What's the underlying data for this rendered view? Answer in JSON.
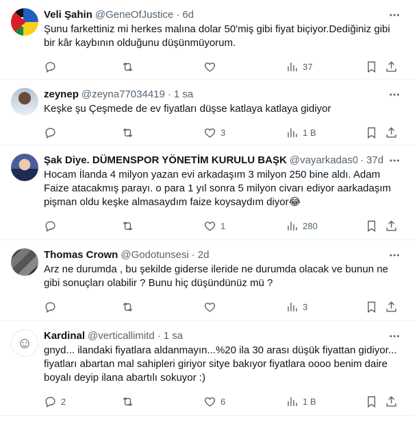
{
  "tweets": [
    {
      "name": "Veli Şahin",
      "handle": "@GeneOfJustice",
      "time": "6d",
      "text": "Şunu farkettiniz mi herkes malına dolar 50'miş gibi fiyat biçiyor.Dediğiniz gibi bir kâr kaybının olduğunu düşünmüyorum.",
      "replies": "",
      "retweets": "",
      "likes": "",
      "views": "37",
      "avatar_icon": "flag-avatar"
    },
    {
      "name": "zeynep",
      "handle": "@zeyna77034419",
      "time": "1 sa",
      "text": "Keşke şu Çeşmede de ev fiyatları düşse katlaya katlaya gidiyor",
      "replies": "",
      "retweets": "",
      "likes": "3",
      "views": "1 B",
      "avatar_icon": "photo-avatar"
    },
    {
      "name": "Şak Diye. DÜMENSPOR YÖNETİM KURULU BAŞK",
      "handle": "@vayarkadas0",
      "time": "37d",
      "text": "Hocam İlanda 4 milyon yazan evi arkadaşım 3 milyon 250 bine aldı. Adam Faize atacakmış parayı. o para 1 yıl sonra 5 milyon civarı ediyor aarkadaşım pişman oldu keşke almasaydım faize koysaydım diyor😂",
      "replies": "",
      "retweets": "",
      "likes": "1",
      "views": "280",
      "avatar_icon": "photo-avatar"
    },
    {
      "name": "Thomas Crown",
      "handle": "@Godotunsesi",
      "time": "2d",
      "text": "Arz ne durumda , bu şekilde giderse ileride ne durumda olacak ve bunun ne gibi sonuçları olabilir ? Bunu hiç düşündünüz mü ?",
      "replies": "",
      "retweets": "",
      "likes": "",
      "views": "3",
      "avatar_icon": "photo-avatar"
    },
    {
      "name": "Kardinal",
      "handle": "@verticallimitd",
      "time": "1 sa",
      "text": "gnyd... ilandaki fiyatlara aldanmayın...%20 ila 30 arası düşük fiyattan gidiyor... fiyatları abartan mal sahipleri giriyor sitye bakıyor fiyatlara oooo benim daire boyalı deyip ilana abartılı sokuyor :)",
      "replies": "2",
      "retweets": "",
      "likes": "6",
      "views": "1 B",
      "avatar_icon": "wojak-avatar"
    }
  ],
  "separator": "·",
  "colors": {
    "text": "#0f1419",
    "secondary": "#536471",
    "border": "#eff3f4"
  }
}
